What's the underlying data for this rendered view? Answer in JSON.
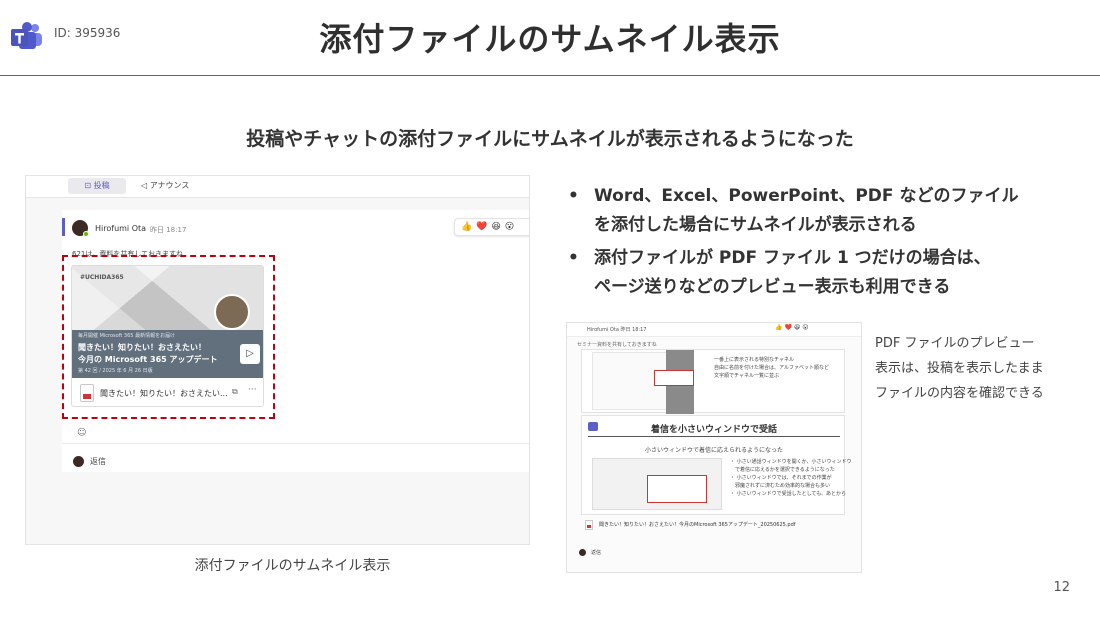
{
  "header": {
    "logo_icon": "teams-logo-icon",
    "slide_id": "ID: 395936",
    "title": "添付ファイルのサムネイル表示"
  },
  "subtitle": "投稿やチャットの添付ファイルにサムネイルが表示されるようになった",
  "left_screenshot": {
    "tabs": [
      {
        "label": "投稿",
        "icon": "chat-icon",
        "active": true
      },
      {
        "label": "アナウンス",
        "icon": "megaphone-icon",
        "active": false
      }
    ],
    "post": {
      "author": "Hirofumi Ota",
      "time": "昨日 18:17",
      "reactions": "👍❤️😆😮",
      "message": "621は、資料を共有しておきますね",
      "card": {
        "brand": "#UCHIDA365",
        "band_small": "毎月開催 Microsoft 365 最新情報をお届け",
        "band_line1": "聞きたい！知りたい！おさえたい！",
        "band_line2": "今月の Microsoft 365 アップデート",
        "band_date": "第 42 回 / 2025 年 6 月 26 日版",
        "play_icon": "play-icon",
        "file_icon": "pdf-file-icon",
        "file_name": "聞きたい！知りたい！おさえたい...",
        "more_icon": "more-icon"
      },
      "add_reaction_icon": "add-reaction-icon",
      "reply_label": "返信"
    },
    "caption": "添付ファイルのサムネイル表示"
  },
  "bullets": [
    {
      "line1": "Word、Excel、PowerPoint、PDF などのファイル",
      "line2": "を添付した場合にサムネイルが表示される"
    },
    {
      "line1": "添付ファイルが PDF ファイル 1 つだけの場合は、",
      "line2": "ページ送りなどのプレビュー表示も利用できる"
    }
  ],
  "right_screenshot": {
    "top_text": "Hirofumi Ota  昨日 18:17",
    "top_reactions": "👍❤️😆😮",
    "sub_text": "セミナー資料を共有しておきますね",
    "page1_lines": [
      "一番上に表示される特別なチャネル",
      "自由に名前を付けた場合は、アルファベット順など",
      "文字順でチャネル一覧に並ぶ"
    ],
    "page2_title": "着信を小さいウィンドウで受話",
    "page2_sub": "小さいウィンドウで着信に応えられるようになった",
    "page2_lines": [
      "・ 小さい通話ウィンドウを開くか、小さいウィンドウ",
      "　で着信に応えるかを選択できるようになった",
      "・ 小さいウィンドウでは、それまでの作業が",
      "　邪魔されずに済むため効率的な場合も多い",
      "・ 小さいウィンドウで受話したとしても、あとから"
    ],
    "file_name": "聞きたい！知りたい！おさえたい！今月のMicrosoft 365アップデート_20250625.pdf",
    "reply_label": "返信"
  },
  "right_caption": [
    "PDF ファイルのプレビュー",
    "表示は、投稿を表示したまま",
    "ファイルの内容を確認できる"
  ],
  "page_number": "12",
  "colors": {
    "accent": "#5b5fc7",
    "highlight_border": "#c0000f",
    "presence": "#6bb700"
  }
}
